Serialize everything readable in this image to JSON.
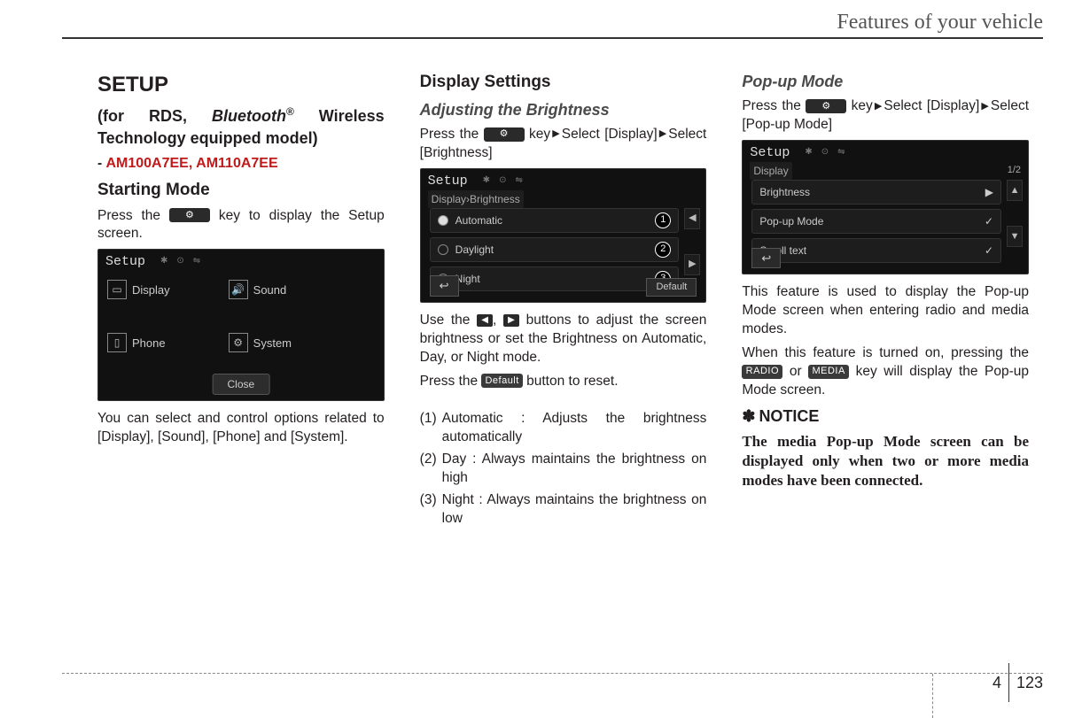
{
  "header": {
    "running_title": "Features of your vehicle"
  },
  "footer": {
    "section": "4",
    "page": "123"
  },
  "col1": {
    "h_setup": "SETUP",
    "h_for_rds_pre": "(for RDS, ",
    "h_bluetooth": "Bluetooth",
    "h_reg": "®",
    "h_for_rds_post": " Wireless Technology equipped model)",
    "dash": "- ",
    "model_codes": "AM100A7EE, AM110A7EE",
    "h_start": "Starting Mode",
    "p_press_pre": "Press the ",
    "p_press_post": " key to display the Setup screen.",
    "p_select": "You can select and control options related to [Display], [Sound], [Phone] and [System].",
    "ss": {
      "title": "Setup",
      "tiles": {
        "display": "Display",
        "sound": "Sound",
        "phone": "Phone",
        "system": "System"
      },
      "close": "Close"
    }
  },
  "col2": {
    "h_display": "Display Settings",
    "h_adjust": "Adjusting the Brightness",
    "p1_pre": "Press the ",
    "p1_key_post": " key",
    "p1_sel1": "Select [Display]",
    "p1_sel2": "Select [Brightness]",
    "ss": {
      "title": "Setup",
      "crumb": "Display›Brightness",
      "opts": {
        "auto": "Automatic",
        "day": "Daylight",
        "night": "Night"
      },
      "default": "Default"
    },
    "p_use_pre": "Use the ",
    "p_use_mid": ", ",
    "p_use_post": " buttons to adjust the screen brightness or set the Brightness on Automatic, Day, or Night mode.",
    "p_reset_pre": "Press the ",
    "p_reset_post": " button to reset.",
    "default_btn": "Default",
    "items": {
      "n1": "(1)",
      "t1_lead": "Automatic : ",
      "t1": "Adjusts the brightness automatically",
      "n2": "(2)",
      "t2_lead": "Day : ",
      "t2": "Always maintains the brightness on high",
      "n3": "(3)",
      "t3_lead": "Night : ",
      "t3": "Always maintains the brightness on low"
    }
  },
  "col3": {
    "h_popup": "Pop-up Mode",
    "p1_pre": "Press the ",
    "p1_key_post": " key",
    "p1_sel1": "Select [Display]",
    "p1_sel2": "Select [Pop-up Mode]",
    "ss": {
      "title": "Setup",
      "crumb": "Display",
      "page_ind": "1/2",
      "rows": {
        "brightness": "Brightness",
        "popup": "Pop-up Mode",
        "scroll": "Scroll text"
      }
    },
    "p_feature": "This feature is used to display the Pop-up Mode screen when entering radio and media modes.",
    "p_when_pre": "When this feature is turned on, pressing the ",
    "radio": "RADIO",
    "or": " or ",
    "media": "MEDIA",
    "p_when_post": " key will display the Pop-up Mode screen.",
    "notice_head": "NOTICE",
    "notice_body": "The media Pop-up Mode screen can be displayed only when two or more media modes have been connected."
  }
}
